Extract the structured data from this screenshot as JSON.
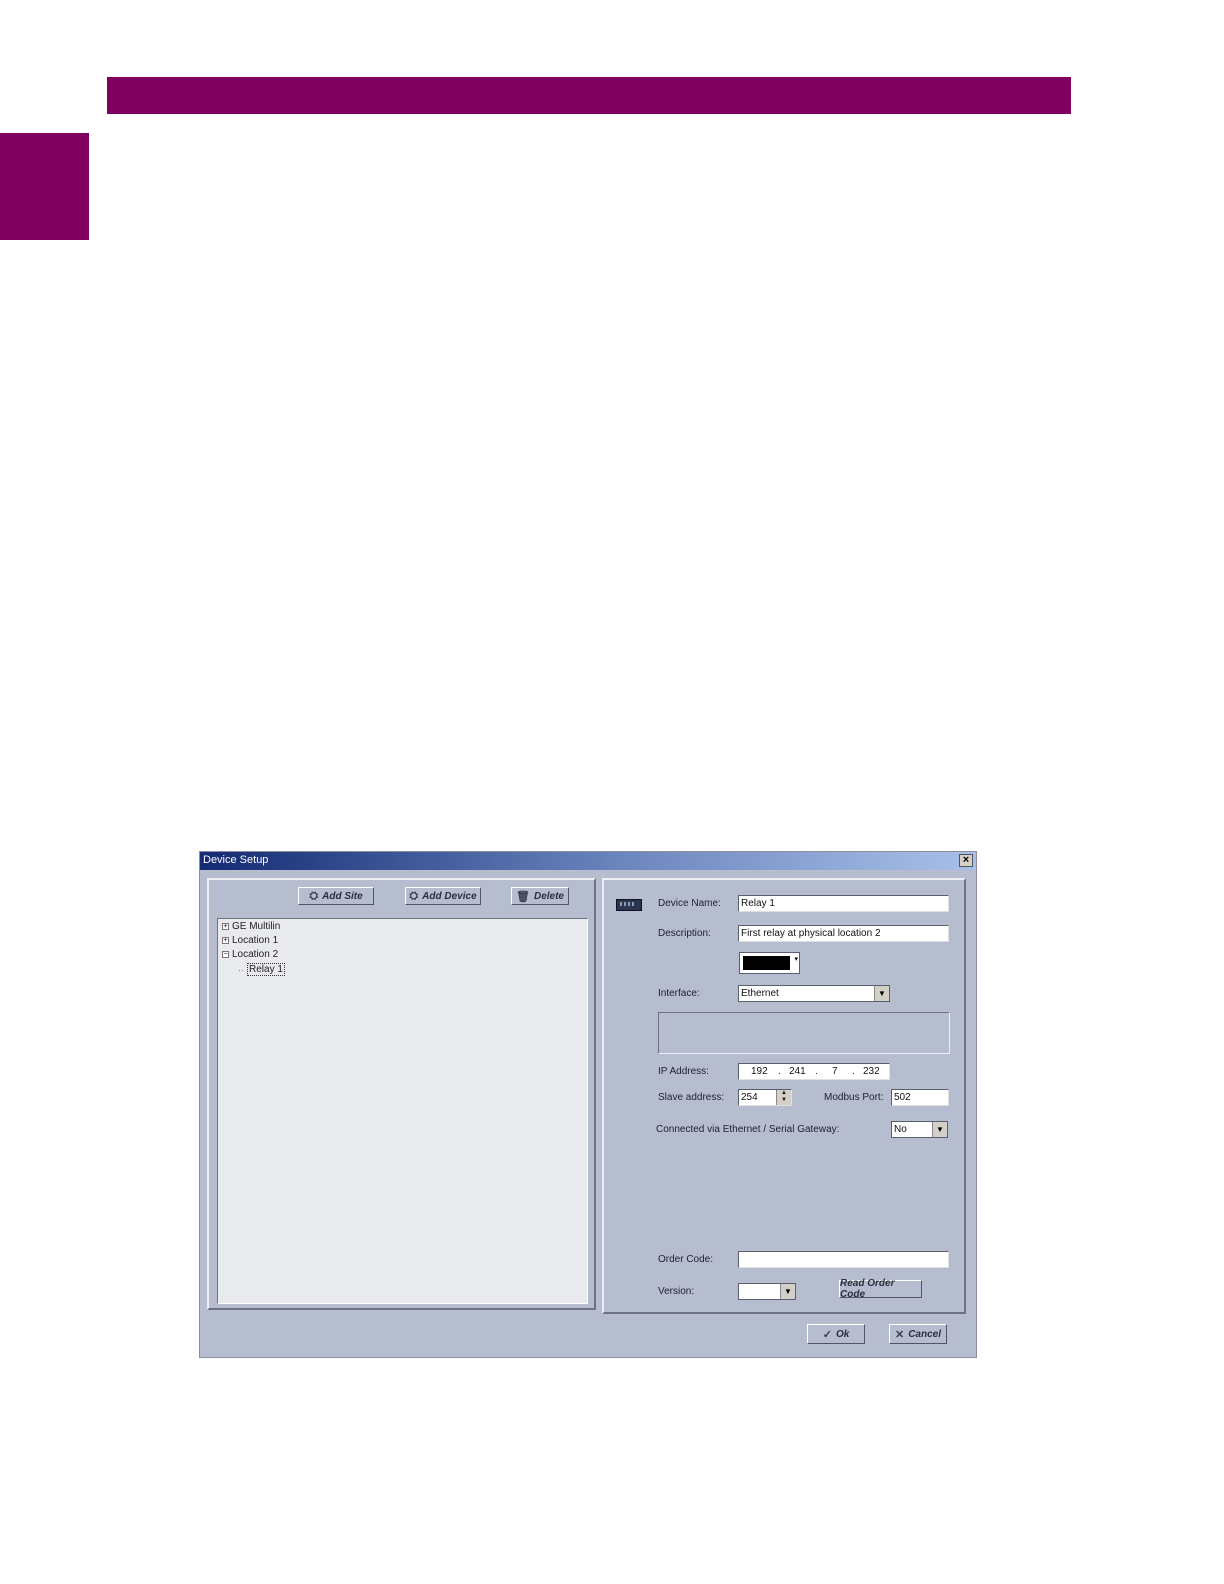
{
  "dialog": {
    "title": "Device Setup",
    "close_symbol": "×"
  },
  "toolbar": {
    "add_site": "Add Site",
    "add_device": "Add Device",
    "delete": "Delete"
  },
  "tree": {
    "items": [
      {
        "label": "GE Multilin",
        "expander": "+"
      },
      {
        "label": "Location 1",
        "expander": "+"
      },
      {
        "label": "Location 2",
        "expander": "−"
      },
      {
        "label": "Relay 1",
        "expander": ""
      }
    ]
  },
  "form": {
    "device_name_label": "Device Name:",
    "device_name_value": "Relay 1",
    "description_label": "Description:",
    "description_value": "First relay at physical location 2",
    "color_value": "#000000",
    "interface_label": "Interface:",
    "interface_value": "Ethernet",
    "ip_label": "IP Address:",
    "ip_octets": [
      "192",
      "241",
      "7",
      "232"
    ],
    "slave_label": "Slave address:",
    "slave_value": "254",
    "modbus_label": "Modbus Port:",
    "modbus_value": "502",
    "gateway_label": "Connected via Ethernet / Serial Gateway:",
    "gateway_value": "No",
    "order_code_label": "Order Code:",
    "order_code_value": "",
    "version_label": "Version:",
    "version_value": "",
    "read_order_code": "Read Order Code"
  },
  "footer": {
    "ok": "Ok",
    "cancel": "Cancel"
  },
  "colors": {
    "brand": "#800060",
    "dialog_bg": "#b6bdce"
  }
}
